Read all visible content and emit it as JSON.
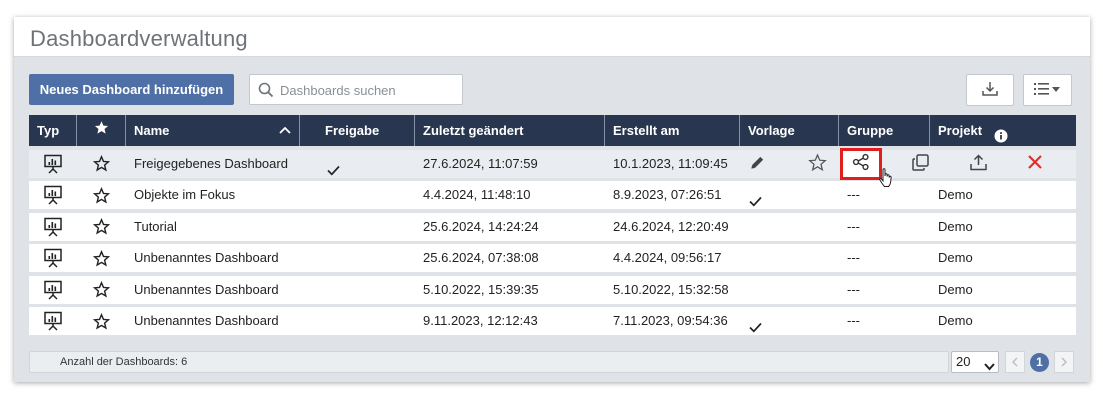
{
  "header": {
    "title": "Dashboardverwaltung"
  },
  "toolbar": {
    "add_label": "Neues Dashboard hinzufügen",
    "search_placeholder": "Dashboards suchen"
  },
  "columns": {
    "typ": "Typ",
    "name": "Name",
    "freigabe": "Freigabe",
    "zuletzt": "Zuletzt geändert",
    "erstellt": "Erstellt am",
    "vorlage": "Vorlage",
    "gruppe": "Gruppe",
    "projekt": "Projekt"
  },
  "rows": [
    {
      "name": "Freigegebenes Dashboard",
      "freigabe": "✓",
      "zuletzt": "27.6.2024, 11:07:59",
      "erstellt": "10.1.2023, 11:09:45",
      "vorlage": "",
      "gruppe": "",
      "projekt": ""
    },
    {
      "name": "Objekte im Fokus",
      "freigabe": "",
      "zuletzt": "4.4.2024, 11:48:10",
      "erstellt": "8.9.2023, 07:26:51",
      "vorlage": "✓",
      "gruppe": "---",
      "projekt": "Demo"
    },
    {
      "name": "Tutorial",
      "freigabe": "",
      "zuletzt": "25.6.2024, 14:24:24",
      "erstellt": "24.6.2024, 12:20:49",
      "vorlage": "",
      "gruppe": "---",
      "projekt": "Demo"
    },
    {
      "name": "Unbenanntes Dashboard",
      "freigabe": "",
      "zuletzt": "25.6.2024, 07:38:08",
      "erstellt": "4.4.2024, 09:56:17",
      "vorlage": "",
      "gruppe": "---",
      "projekt": "Demo"
    },
    {
      "name": "Unbenanntes Dashboard",
      "freigabe": "",
      "zuletzt": "5.10.2022, 15:39:35",
      "erstellt": "5.10.2022, 15:32:58",
      "vorlage": "",
      "gruppe": "---",
      "projekt": "Demo"
    },
    {
      "name": "Unbenanntes Dashboard",
      "freigabe": "",
      "zuletzt": "9.11.2023, 12:12:43",
      "erstellt": "7.11.2023, 09:54:36",
      "vorlage": "✓",
      "gruppe": "---",
      "projekt": "Demo"
    }
  ],
  "footer": {
    "count_text": "Anzahl der Dashboards: 6",
    "page_size": "20",
    "current_page": "1"
  },
  "icons": {
    "row_actions": [
      "pencil-icon",
      "star-icon",
      "share-icon",
      "copy-icon",
      "upload-icon",
      "delete-icon"
    ],
    "delete_color": "#e0302e",
    "header_color": "#28374f",
    "accent_color": "#4f70a6"
  }
}
